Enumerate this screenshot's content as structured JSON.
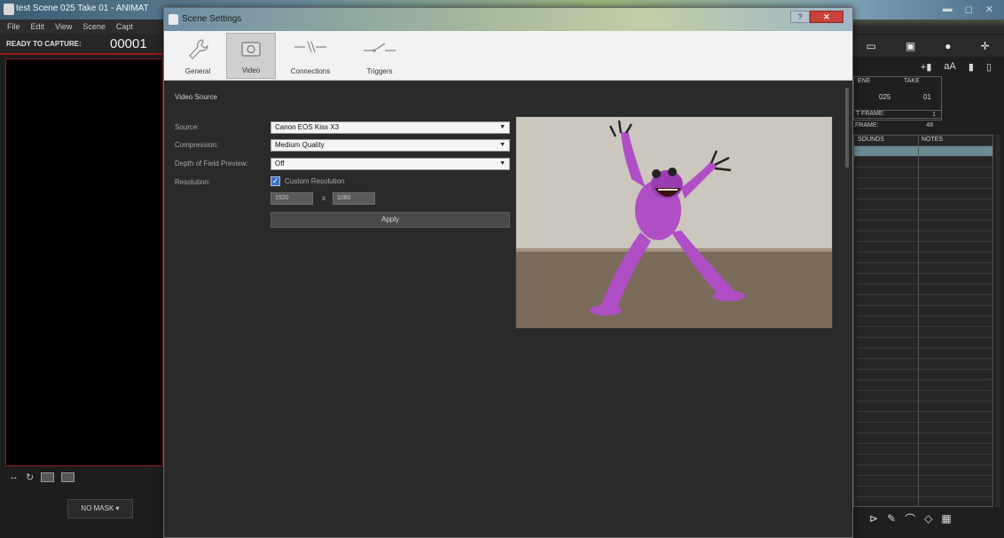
{
  "background_app": {
    "title": "test Scene 025 Take 01 - ANIMAT",
    "menu": [
      "File",
      "Edit",
      "View",
      "Scene",
      "Capt"
    ],
    "capture_label": "READY TO CAPTURE:",
    "frame_counter": "00001",
    "no_mask_button": "NO MASK ▾",
    "right_panel": {
      "scene_header": "ENE",
      "take_header": "TAKE",
      "scene_value": "025",
      "take_value": "01",
      "frame_label": "T FRAME:",
      "frame_value": "1",
      "frames_label": "FRAME:",
      "frames_value": "48",
      "col_sounds": "SOUNDS",
      "col_notes": "NOTES"
    }
  },
  "dialog": {
    "title": "Scene Settings",
    "help_button": "?",
    "close_button": "✕",
    "tabs": [
      {
        "label": "General",
        "icon": "wrench-icon"
      },
      {
        "label": "Video",
        "icon": "camera-icon"
      },
      {
        "label": "Connections",
        "icon": "connections-icon"
      },
      {
        "label": "Triggers",
        "icon": "triggers-icon"
      }
    ],
    "section_title": "Video Source",
    "fields": {
      "source_label": "Source:",
      "source_value": "Canon EOS Kiss X3",
      "compression_label": "Compression:",
      "compression_value": "Medium Quality",
      "dof_label": "Depth of Field Preview:",
      "dof_value": "Off",
      "resolution_label": "Resolution:",
      "custom_resolution_label": "Custom Resolution",
      "width_value": "1920",
      "height_value": "1080",
      "times_sign": "x"
    },
    "apply_button": "Apply"
  }
}
